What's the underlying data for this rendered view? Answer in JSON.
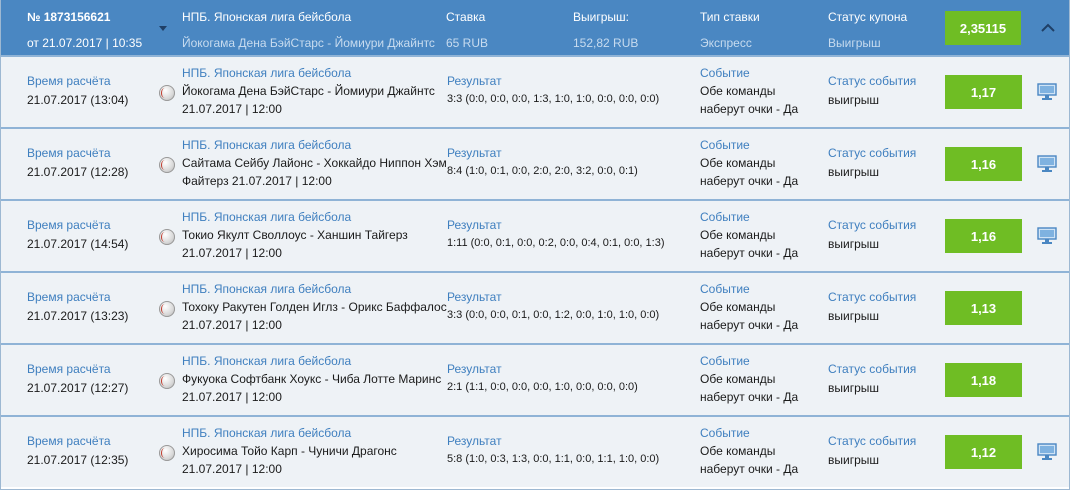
{
  "coupon": {
    "number": "№ 1873156621",
    "date": "от 21.07.2017 | 10:35",
    "league": "НПБ. Японская лига бейсбола",
    "match": "Йокогама Дена БэйСтарс - Йомиури Джайнтс",
    "stake_label": "Ставка",
    "stake_value": "65 RUB",
    "win_label": "Выигрыш:",
    "win_value": "152,82 RUB",
    "bet_type_label": "Тип ставки",
    "bet_type_value": "Экспресс",
    "status_label": "Статус купона",
    "status_value": "Выигрыш",
    "total_coef": "2,35115"
  },
  "labels": {
    "calc_time": "Время расчёта",
    "result": "Результат",
    "event": "Событие",
    "event_status": "Статус события"
  },
  "events": [
    {
      "calc_time": "21.07.2017 (13:04)",
      "league": "НПБ. Японская лига бейсбола",
      "match_line1": "Йокогама Дена БэйСтарс - Йомиури Джайнтс",
      "match_line2": "21.07.2017 | 12:00",
      "result": "3:3 (0:0, 0:0, 0:0, 1:3, 1:0, 1:0, 0:0, 0:0, 0:0)",
      "event_line1": "Обе команды",
      "event_line2": "наберут очки - Да",
      "status": "выигрыш",
      "coef": "1,17",
      "has_monitor": true
    },
    {
      "calc_time": "21.07.2017 (12:28)",
      "league": "НПБ. Японская лига бейсбола",
      "match_line1": "Сайтама Сейбу Лайонс - Хоккайдо Ниппон Хэм",
      "match_line2": "Файтерз 21.07.2017 | 12:00",
      "result": "8:4 (1:0, 0:1, 0:0, 2:0, 2:0, 3:2, 0:0, 0:1)",
      "event_line1": "Обе команды",
      "event_line2": "наберут очки - Да",
      "status": "выигрыш",
      "coef": "1,16",
      "has_monitor": true
    },
    {
      "calc_time": "21.07.2017 (14:54)",
      "league": "НПБ. Японская лига бейсбола",
      "match_line1": "Токио Якулт Своллоус - Ханшин Тайгерз",
      "match_line2": "21.07.2017 | 12:00",
      "result": "1:11 (0:0, 0:1, 0:0, 0:2, 0:0, 0:4, 0:1, 0:0, 1:3)",
      "event_line1": "Обе команды",
      "event_line2": "наберут очки - Да",
      "status": "выигрыш",
      "coef": "1,16",
      "has_monitor": true
    },
    {
      "calc_time": "21.07.2017 (13:23)",
      "league": "НПБ. Японская лига бейсбола",
      "match_line1": "Тохоку Ракутен Голден Иглз - Орикс Баффалос",
      "match_line2": "21.07.2017 | 12:00",
      "result": "3:3 (0:0, 0:0, 0:1, 0:0, 1:2, 0:0, 1:0, 1:0, 0:0)",
      "event_line1": "Обе команды",
      "event_line2": "наберут очки - Да",
      "status": "выигрыш",
      "coef": "1,13",
      "has_monitor": false
    },
    {
      "calc_time": "21.07.2017 (12:27)",
      "league": "НПБ. Японская лига бейсбола",
      "match_line1": "Фукуока Софтбанк Хоукс - Чиба Лотте Маринс",
      "match_line2": "21.07.2017 | 12:00",
      "result": "2:1 (1:1, 0:0, 0:0, 0:0, 1:0, 0:0, 0:0, 0:0)",
      "event_line1": "Обе команды",
      "event_line2": "наберут очки - Да",
      "status": "выигрыш",
      "coef": "1,18",
      "has_monitor": false
    },
    {
      "calc_time": "21.07.2017 (12:35)",
      "league": "НПБ. Японская лига бейсбола",
      "match_line1": "Хиросима Тойо Карп - Чуничи Драгонс",
      "match_line2": "21.07.2017 | 12:00",
      "result": "5:8 (1:0, 0:3, 1:3, 0:0, 1:1, 0:0, 1:1, 1:0, 0:0)",
      "event_line1": "Обе команды",
      "event_line2": "наберут очки - Да",
      "status": "выигрыш",
      "coef": "1,12",
      "has_monitor": true
    }
  ],
  "colors": {
    "header_bg": "#4a87c2",
    "accent_link": "#3f7fbf",
    "coef_green": "#6fbd24",
    "row_bg": "#eef2f6"
  },
  "icons": {
    "sport": "baseball-icon",
    "broadcast": "monitor-icon",
    "collapse": "chevron-up-icon",
    "expand": "caret-down-icon"
  }
}
